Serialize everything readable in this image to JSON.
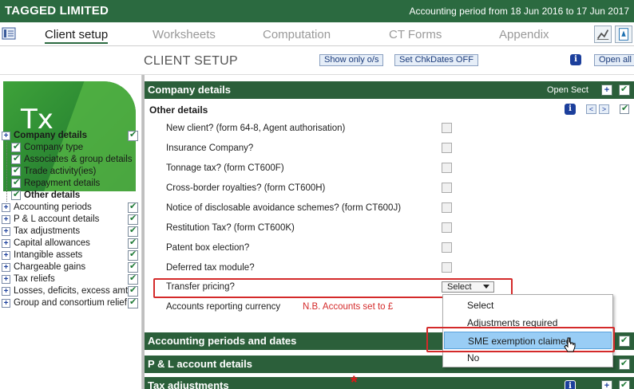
{
  "titlebar": {
    "company": "TAGGED LIMITED",
    "period": "Accounting period from 18 Jun 2016 to 17 Jun 2017"
  },
  "nav": {
    "tabs": [
      {
        "label": "Client setup",
        "active": true
      },
      {
        "label": "Worksheets"
      },
      {
        "label": "Computation"
      },
      {
        "label": "CT Forms"
      },
      {
        "label": "Appendix"
      }
    ]
  },
  "header": {
    "title": "CLIENT SETUP",
    "show_only_label": "Show only o/s",
    "set_chk_label": "Set ChkDates OFF",
    "open_all_label": "Open all",
    "info_glyph": "i"
  },
  "logo": {
    "text": "Tx"
  },
  "sidebar": {
    "items": [
      {
        "label": "Company details",
        "bold": true,
        "expander": "+",
        "checked": true
      },
      {
        "label": "Company type",
        "child": true,
        "checked": true
      },
      {
        "label": "Associates & group details",
        "child": true,
        "checked": true
      },
      {
        "label": "Trade activity(ies)",
        "child": true,
        "checked": true
      },
      {
        "label": "Repayment details",
        "child": true,
        "checked": true
      },
      {
        "label": "Other details",
        "child": true,
        "bold": true,
        "checked": true
      },
      {
        "label": "Accounting periods",
        "expander": "+",
        "checked": true
      },
      {
        "label": "P & L account details",
        "expander": "+",
        "checked": true
      },
      {
        "label": "Tax adjustments",
        "expander": "+",
        "checked": true
      },
      {
        "label": "Capital allowances",
        "expander": "+",
        "checked": true
      },
      {
        "label": "Intangible assets",
        "expander": "+",
        "checked": true
      },
      {
        "label": "Chargeable gains",
        "expander": "+",
        "checked": true
      },
      {
        "label": "Tax reliefs",
        "expander": "+",
        "checked": true
      },
      {
        "label": "Losses, deficits, excess amts",
        "expander": "+",
        "checked": true
      },
      {
        "label": "Group and consortium relief",
        "expander": "+",
        "checked": true
      }
    ]
  },
  "content": {
    "company_section": {
      "title": "Company details",
      "open_sect_label": "Open Sect",
      "plus": "+"
    },
    "other_details": {
      "title": "Other details",
      "prev": "<",
      "next": ">",
      "info_glyph": "i"
    },
    "fields": [
      {
        "label": "New client?  (form 64-8, Agent authorisation)"
      },
      {
        "label": "Insurance Company?"
      },
      {
        "label": "Tonnage tax?  (form CT600F)"
      },
      {
        "label": "Cross-border royalties?  (form CT600H)"
      },
      {
        "label": "Notice of disclosable avoidance schemes?  (form CT600J)"
      },
      {
        "label": "Restitution Tax?  (form CT600K)"
      },
      {
        "label": "Patent box election?"
      },
      {
        "label": "Deferred tax module?"
      }
    ],
    "transfer_pricing": {
      "label": "Transfer pricing?",
      "select_value": "Select"
    },
    "currency": {
      "label": "Accounts reporting currency",
      "note": "N.B. Accounts set to £"
    },
    "sections": [
      {
        "title": "Accounting periods and dates"
      },
      {
        "title": "P & L account details"
      },
      {
        "title": "Tax adjustments",
        "marker": "*"
      }
    ],
    "dropdown": {
      "options": [
        {
          "label": "Select"
        },
        {
          "label": "Adjustments required"
        },
        {
          "label": "SME exemption claimed",
          "highlighted": true
        },
        {
          "label": "No"
        }
      ]
    }
  },
  "colors": {
    "brand_green": "#2b6a40",
    "section_green": "#2b5f3a",
    "highlight": "#99cdf5",
    "annotation_red": "#d42a2a"
  }
}
